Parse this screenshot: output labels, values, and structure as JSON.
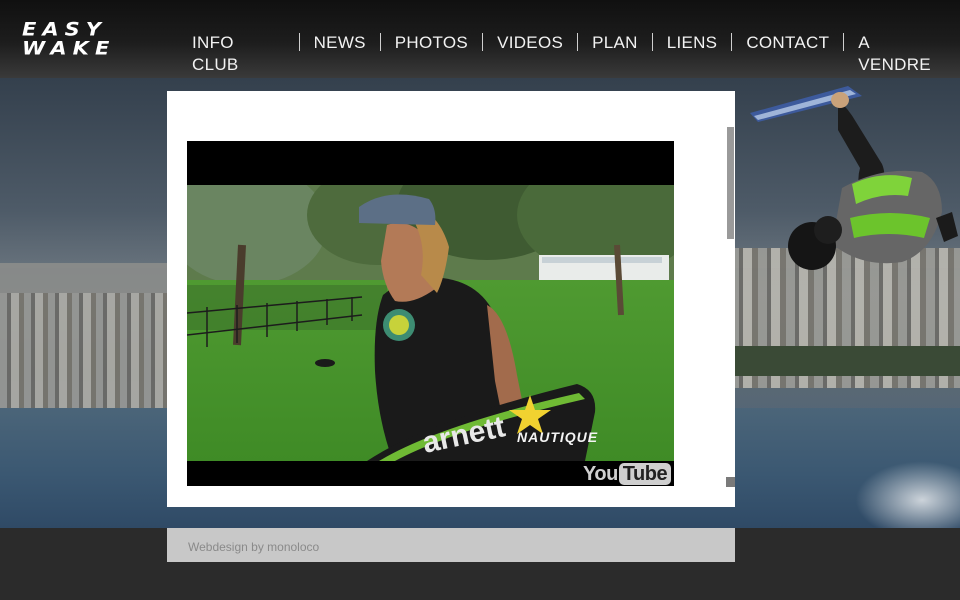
{
  "brand": {
    "logo_line1": "EASY",
    "logo_line2": "WAKE"
  },
  "nav": {
    "items": [
      "INFO CLUB",
      "NEWS",
      "PHOTOS",
      "VIDEOS",
      "PLAN",
      "LIENS",
      "CONTACT",
      "A VENDRE"
    ]
  },
  "video": {
    "board_text": "arnett",
    "brand_overlay": "NAUTIQUE",
    "youtube_logo_you": "You",
    "youtube_logo_tube": "Tube"
  },
  "footer": {
    "credit": "Webdesign by monoloco"
  },
  "colors": {
    "header_bg": "#1d1d1d",
    "panel_bg": "#ffffff",
    "footer_bg": "#c8c8c8",
    "page_bg": "#2b2b2b",
    "nav_text": "#f2f2f2"
  },
  "icons": [
    "youtube-logo",
    "rockstar-star-icon"
  ]
}
